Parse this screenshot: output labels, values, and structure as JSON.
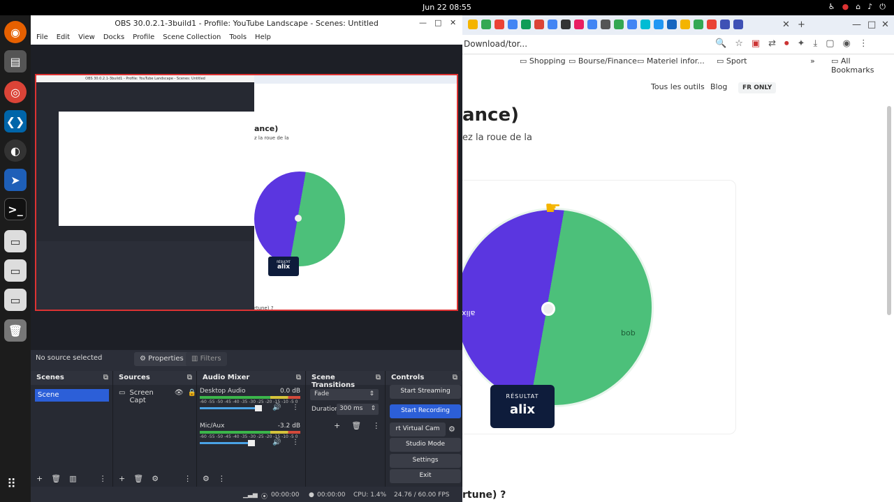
{
  "topbar": {
    "clock": "Jun 22  08:55"
  },
  "obs": {
    "title": "OBS 30.0.2.1-3build1 - Profile: YouTube Landscape - Scenes: Untitled",
    "menu": [
      "File",
      "Edit",
      "View",
      "Docks",
      "Profile",
      "Scene Collection",
      "Tools",
      "Help"
    ],
    "no_source": "No source selected",
    "properties": "Properties",
    "filters": "Filters",
    "scenes": {
      "title": "Scenes",
      "items": [
        "Scene"
      ]
    },
    "sources": {
      "title": "Sources",
      "items": [
        "Screen Capt"
      ]
    },
    "mixer": {
      "title": "Audio Mixer",
      "channels": [
        {
          "name": "Desktop Audio",
          "db": "0.0 dB",
          "level": 0.62
        },
        {
          "name": "Mic/Aux",
          "db": "-3.2 dB",
          "level": 0.55
        }
      ],
      "ticks": "-60 -55 -50 -45 -40 -35 -30 -25 -20 -15 -10 -5 0"
    },
    "transitions": {
      "title": "Scene Transitions",
      "type": "Fade",
      "duration_label": "Duration",
      "duration": "300 ms"
    },
    "controls": {
      "title": "Controls",
      "start_streaming": "Start Streaming",
      "start_recording": "Start Recording",
      "virtual_camera": "rt Virtual Cam",
      "studio_mode": "Studio Mode",
      "settings": "Settings",
      "exit": "Exit"
    },
    "status": {
      "stream_time": "00:00:00",
      "rec_time": "00:00:00",
      "cpu": "CPU: 1.4%",
      "fps": "24.76 / 60.00 FPS"
    }
  },
  "chrome": {
    "url": "Download/tor...",
    "bookmarks": [
      "Shopping",
      "Bourse/Finance",
      "Materiel infor...",
      "Sport"
    ],
    "all_bookmarks": "All Bookmarks",
    "nav": {
      "tools": "Tous les outils",
      "blog": "Blog",
      "badge": "FR ONLY"
    },
    "heading": "ance)",
    "subtext": "ez la roue de la",
    "wheel": {
      "left": "alix",
      "right": "bob"
    },
    "result_label": "RÉSULTAT",
    "result_value": "alix",
    "bottom_text": "rtune) ?"
  },
  "preview": {
    "heading": "ance)",
    "subtext": "z la roue de la",
    "result_label": "RÉSULTAT",
    "result_value": "alix",
    "bottom_text": "rtune) ?",
    "nested_title": "OBS 30.0.2.1-3build1 - Profile: YouTube Landscape - Scenes: Untitled"
  },
  "colors": {
    "accent": "#2c5fd8",
    "wheel_purple": "#5b36e0",
    "wheel_green": "#4cc07a",
    "result_bg": "#0e1c3b"
  }
}
